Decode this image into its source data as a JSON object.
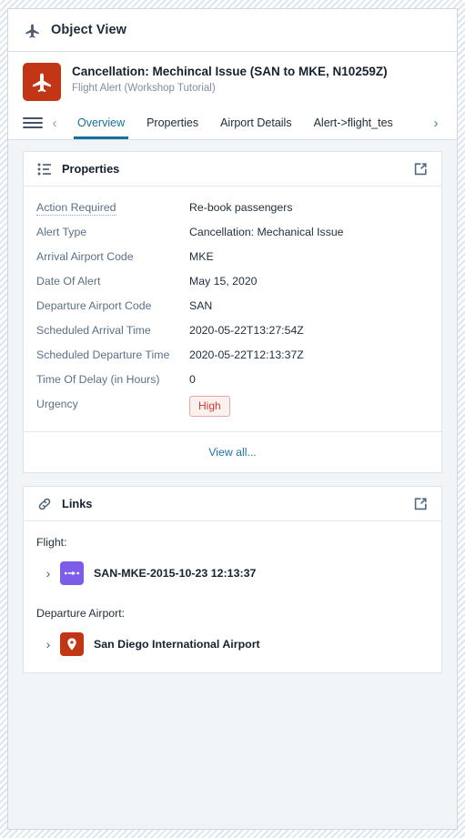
{
  "window": {
    "header_title": "Object View",
    "header_icon": "airplane-icon"
  },
  "object": {
    "icon": "airplane-icon",
    "icon_color": "#c23616",
    "title": "Cancellation: Mechincal Issue (SAN to MKE, N10259Z)",
    "subtitle": "Flight Alert (Workshop Tutorial)"
  },
  "tabbar": {
    "menu_icon": "hamburger-menu-icon",
    "prev_icon": "chevron-left-icon",
    "next_icon": "chevron-right-icon",
    "tabs": [
      {
        "label": "Overview",
        "active": true
      },
      {
        "label": "Properties",
        "active": false
      },
      {
        "label": "Airport Details",
        "active": false
      },
      {
        "label": "Alert->flight_tes",
        "active": false
      }
    ]
  },
  "properties_card": {
    "icon": "list-icon",
    "title": "Properties",
    "popout_icon": "external-link-icon",
    "rows": [
      {
        "label": "Action Required",
        "value": "Re-book passengers",
        "dotted": true,
        "badge": false
      },
      {
        "label": "Alert Type",
        "value": "Cancellation: Mechanical Issue",
        "dotted": false,
        "badge": false
      },
      {
        "label": "Arrival Airport Code",
        "value": "MKE",
        "dotted": false,
        "badge": false
      },
      {
        "label": "Date Of Alert",
        "value": "May 15, 2020",
        "dotted": false,
        "badge": false
      },
      {
        "label": "Departure Airport Code",
        "value": "SAN",
        "dotted": false,
        "badge": false
      },
      {
        "label": "Scheduled Arrival Time",
        "value": "2020-05-22T13:27:54Z",
        "dotted": false,
        "badge": false
      },
      {
        "label": "Scheduled Departure Time",
        "value": "2020-05-22T12:13:37Z",
        "dotted": false,
        "badge": false
      },
      {
        "label": "Time Of Delay (in Hours)",
        "value": "0",
        "dotted": false,
        "badge": false
      },
      {
        "label": "Urgency",
        "value": "High",
        "dotted": false,
        "badge": true
      }
    ],
    "view_all_label": "View all..."
  },
  "links_card": {
    "icon": "link-chain-icon",
    "title": "Links",
    "popout_icon": "external-link-icon",
    "groups": [
      {
        "label": "Flight:",
        "items": [
          {
            "chevron": "chevron-right-icon",
            "icon": "flight-route-icon",
            "icon_color": "#7d5ce8",
            "label": "SAN-MKE-2015-10-23 12:13:37"
          }
        ]
      },
      {
        "label": "Departure Airport:",
        "items": [
          {
            "chevron": "chevron-right-icon",
            "icon": "map-pin-icon",
            "icon_color": "#c23616",
            "label": "San Diego International Airport"
          }
        ]
      }
    ]
  },
  "colors": {
    "accent_blue": "#15709e",
    "badge_red": "#cf3b32",
    "brand_orange": "#c23616",
    "purple": "#7d5ce8",
    "page_background": "#f2f5f8"
  }
}
